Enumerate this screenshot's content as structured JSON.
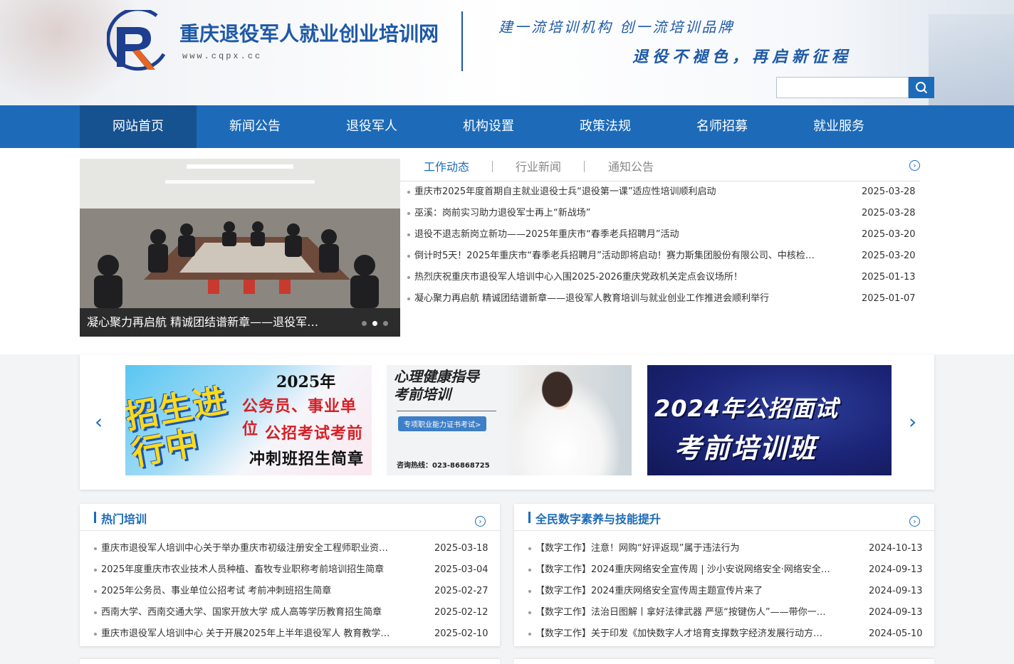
{
  "header": {
    "site_title": "重庆退役军人就业创业培训网",
    "site_url": "www.cqpx.cc",
    "slogan_1": "建一流培训机构  创一流培训品牌",
    "slogan_2": "退役不褪色，再启新征程",
    "search": {
      "value": "",
      "placeholder": ""
    },
    "logo_icon": "R-logo",
    "search_icon": "magnifier-icon",
    "brand_color": "#1d6bb8"
  },
  "nav": {
    "items": [
      {
        "label": "网站首页",
        "active": true
      },
      {
        "label": "新闻公告",
        "active": false
      },
      {
        "label": "退役军人",
        "active": false
      },
      {
        "label": "机构设置",
        "active": false
      },
      {
        "label": "政策法规",
        "active": false
      },
      {
        "label": "名师招募",
        "active": false
      },
      {
        "label": "就业服务",
        "active": false
      }
    ]
  },
  "slider": {
    "caption": "凝心聚力再启航 精诚团结谱新章——退役军…",
    "dots_total": 3,
    "active_dot": 2
  },
  "news_tabs": {
    "tabs": [
      {
        "label": "工作动态",
        "active": true
      },
      {
        "label": "行业新闻",
        "active": false
      },
      {
        "label": "通知公告",
        "active": false
      }
    ],
    "items": [
      {
        "title": "重庆市2025年度首期自主就业退役士兵“退役第一课”适应性培训顺利启动",
        "date": "2025-03-28"
      },
      {
        "title": "巫溪：岗前实习助力退役军士再上“新战场”",
        "date": "2025-03-28"
      },
      {
        "title": "退役不退志新岗立新功——2025年重庆市“春季老兵招聘月”活动",
        "date": "2025-03-20"
      },
      {
        "title": "倒计时5天！2025年重庆市“春季老兵招聘月”活动即将启动！赛力斯集团股份有限公司、中核检…",
        "date": "2025-03-20"
      },
      {
        "title": "热烈庆祝重庆市退役军人培训中心入围2025-2026重庆党政机关定点会议场所！",
        "date": "2025-01-13"
      },
      {
        "title": "凝心聚力再启航 精诚团结谱新章——退役军人教育培训与就业创业工作推进会顺利举行",
        "date": "2025-01-07"
      }
    ]
  },
  "banners": {
    "b1": {
      "year": "2025年",
      "line2": "公务员、事业单位",
      "line3": "公招考试考前",
      "line4": "冲刺班招生简章",
      "big": "招生进行中"
    },
    "b2": {
      "title_1": "心理健康指导",
      "title_2": "考前培训",
      "tag": "专项职业能力证书考试>",
      "tel": "咨询热线：023-86868725"
    },
    "b3": {
      "line1": "2024年公招面试",
      "line2": "考前培训班"
    },
    "prev_icon": "chevron-left-icon",
    "next_icon": "chevron-right-icon"
  },
  "panel_left": {
    "title": "热门培训",
    "items": [
      {
        "title": "重庆市退役军人培训中心关于举办重庆市初级注册安全工程师职业资…",
        "date": "2025-03-18"
      },
      {
        "title": "2025年度重庆市农业技术人员种植、畜牧专业职称考前培训招生简章",
        "date": "2025-03-04"
      },
      {
        "title": "2025年公务员、事业单位公招考试 考前冲刺班招生简章",
        "date": "2025-02-27"
      },
      {
        "title": "西南大学、西南交通大学、国家开放大学 成人高等学历教育招生简章",
        "date": "2025-02-12"
      },
      {
        "title": "重庆市退役军人培训中心 关于开展2025年上半年退役军人 教育教学…",
        "date": "2025-02-10"
      }
    ]
  },
  "panel_right": {
    "title": "全民数字素养与技能提升",
    "items": [
      {
        "title": "【数字工作】注意！网购“好评返现”属于违法行为",
        "date": "2024-10-13"
      },
      {
        "title": "【数字工作】2024重庆网络安全宣传周 | 沙小安说网络安全·网络安全…",
        "date": "2024-09-13"
      },
      {
        "title": "【数字工作】2024重庆网络安全宣传周主题宣传片来了",
        "date": "2024-09-13"
      },
      {
        "title": "【数字工作】法治日图解丨拿好法律武器 严惩“按键伤人”——带你一…",
        "date": "2024-09-13"
      },
      {
        "title": "【数字工作】关于印发《加快数字人才培育支撑数字经济发展行动方…",
        "date": "2024-05-10"
      }
    ]
  },
  "more_icon": "circle-chevron-right-icon"
}
